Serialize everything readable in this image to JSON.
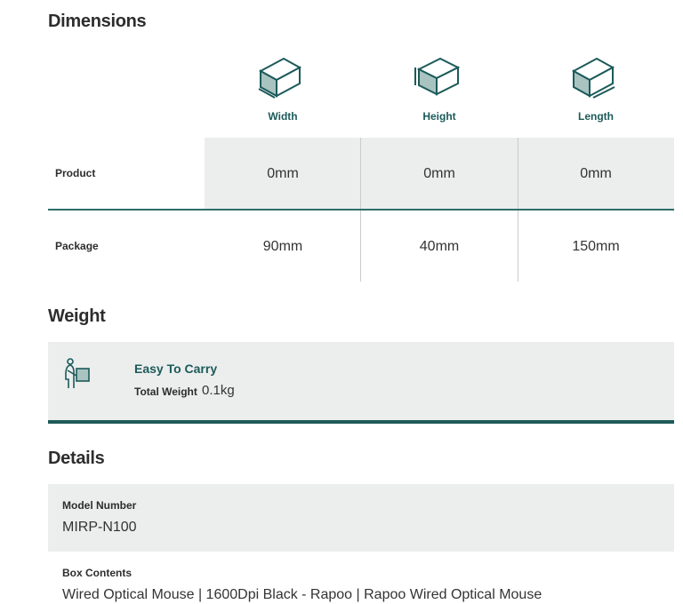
{
  "dimensions": {
    "title": "Dimensions",
    "columns": [
      "Width",
      "Height",
      "Length"
    ],
    "rows": [
      {
        "label": "Product",
        "values": [
          "0mm",
          "0mm",
          "0mm"
        ]
      },
      {
        "label": "Package",
        "values": [
          "90mm",
          "40mm",
          "150mm"
        ]
      }
    ],
    "icons": [
      "box-width-icon",
      "box-height-icon",
      "box-length-icon"
    ]
  },
  "weight": {
    "title": "Weight",
    "tag": "Easy To Carry",
    "label": "Total Weight",
    "value": "0.1kg",
    "icon": "person-carrying-box-icon"
  },
  "details": {
    "title": "Details",
    "items": [
      {
        "label": "Model Number",
        "value": "MIRP-N100"
      },
      {
        "label": "Box Contents",
        "value": "Wired Optical Mouse | 1600Dpi Black - Rapoo | Rapoo Wired Optical Mouse"
      }
    ]
  },
  "colors": {
    "accent": "#1c5a5a",
    "panel": "#ebeeed",
    "divider": "#2e6d6a"
  }
}
